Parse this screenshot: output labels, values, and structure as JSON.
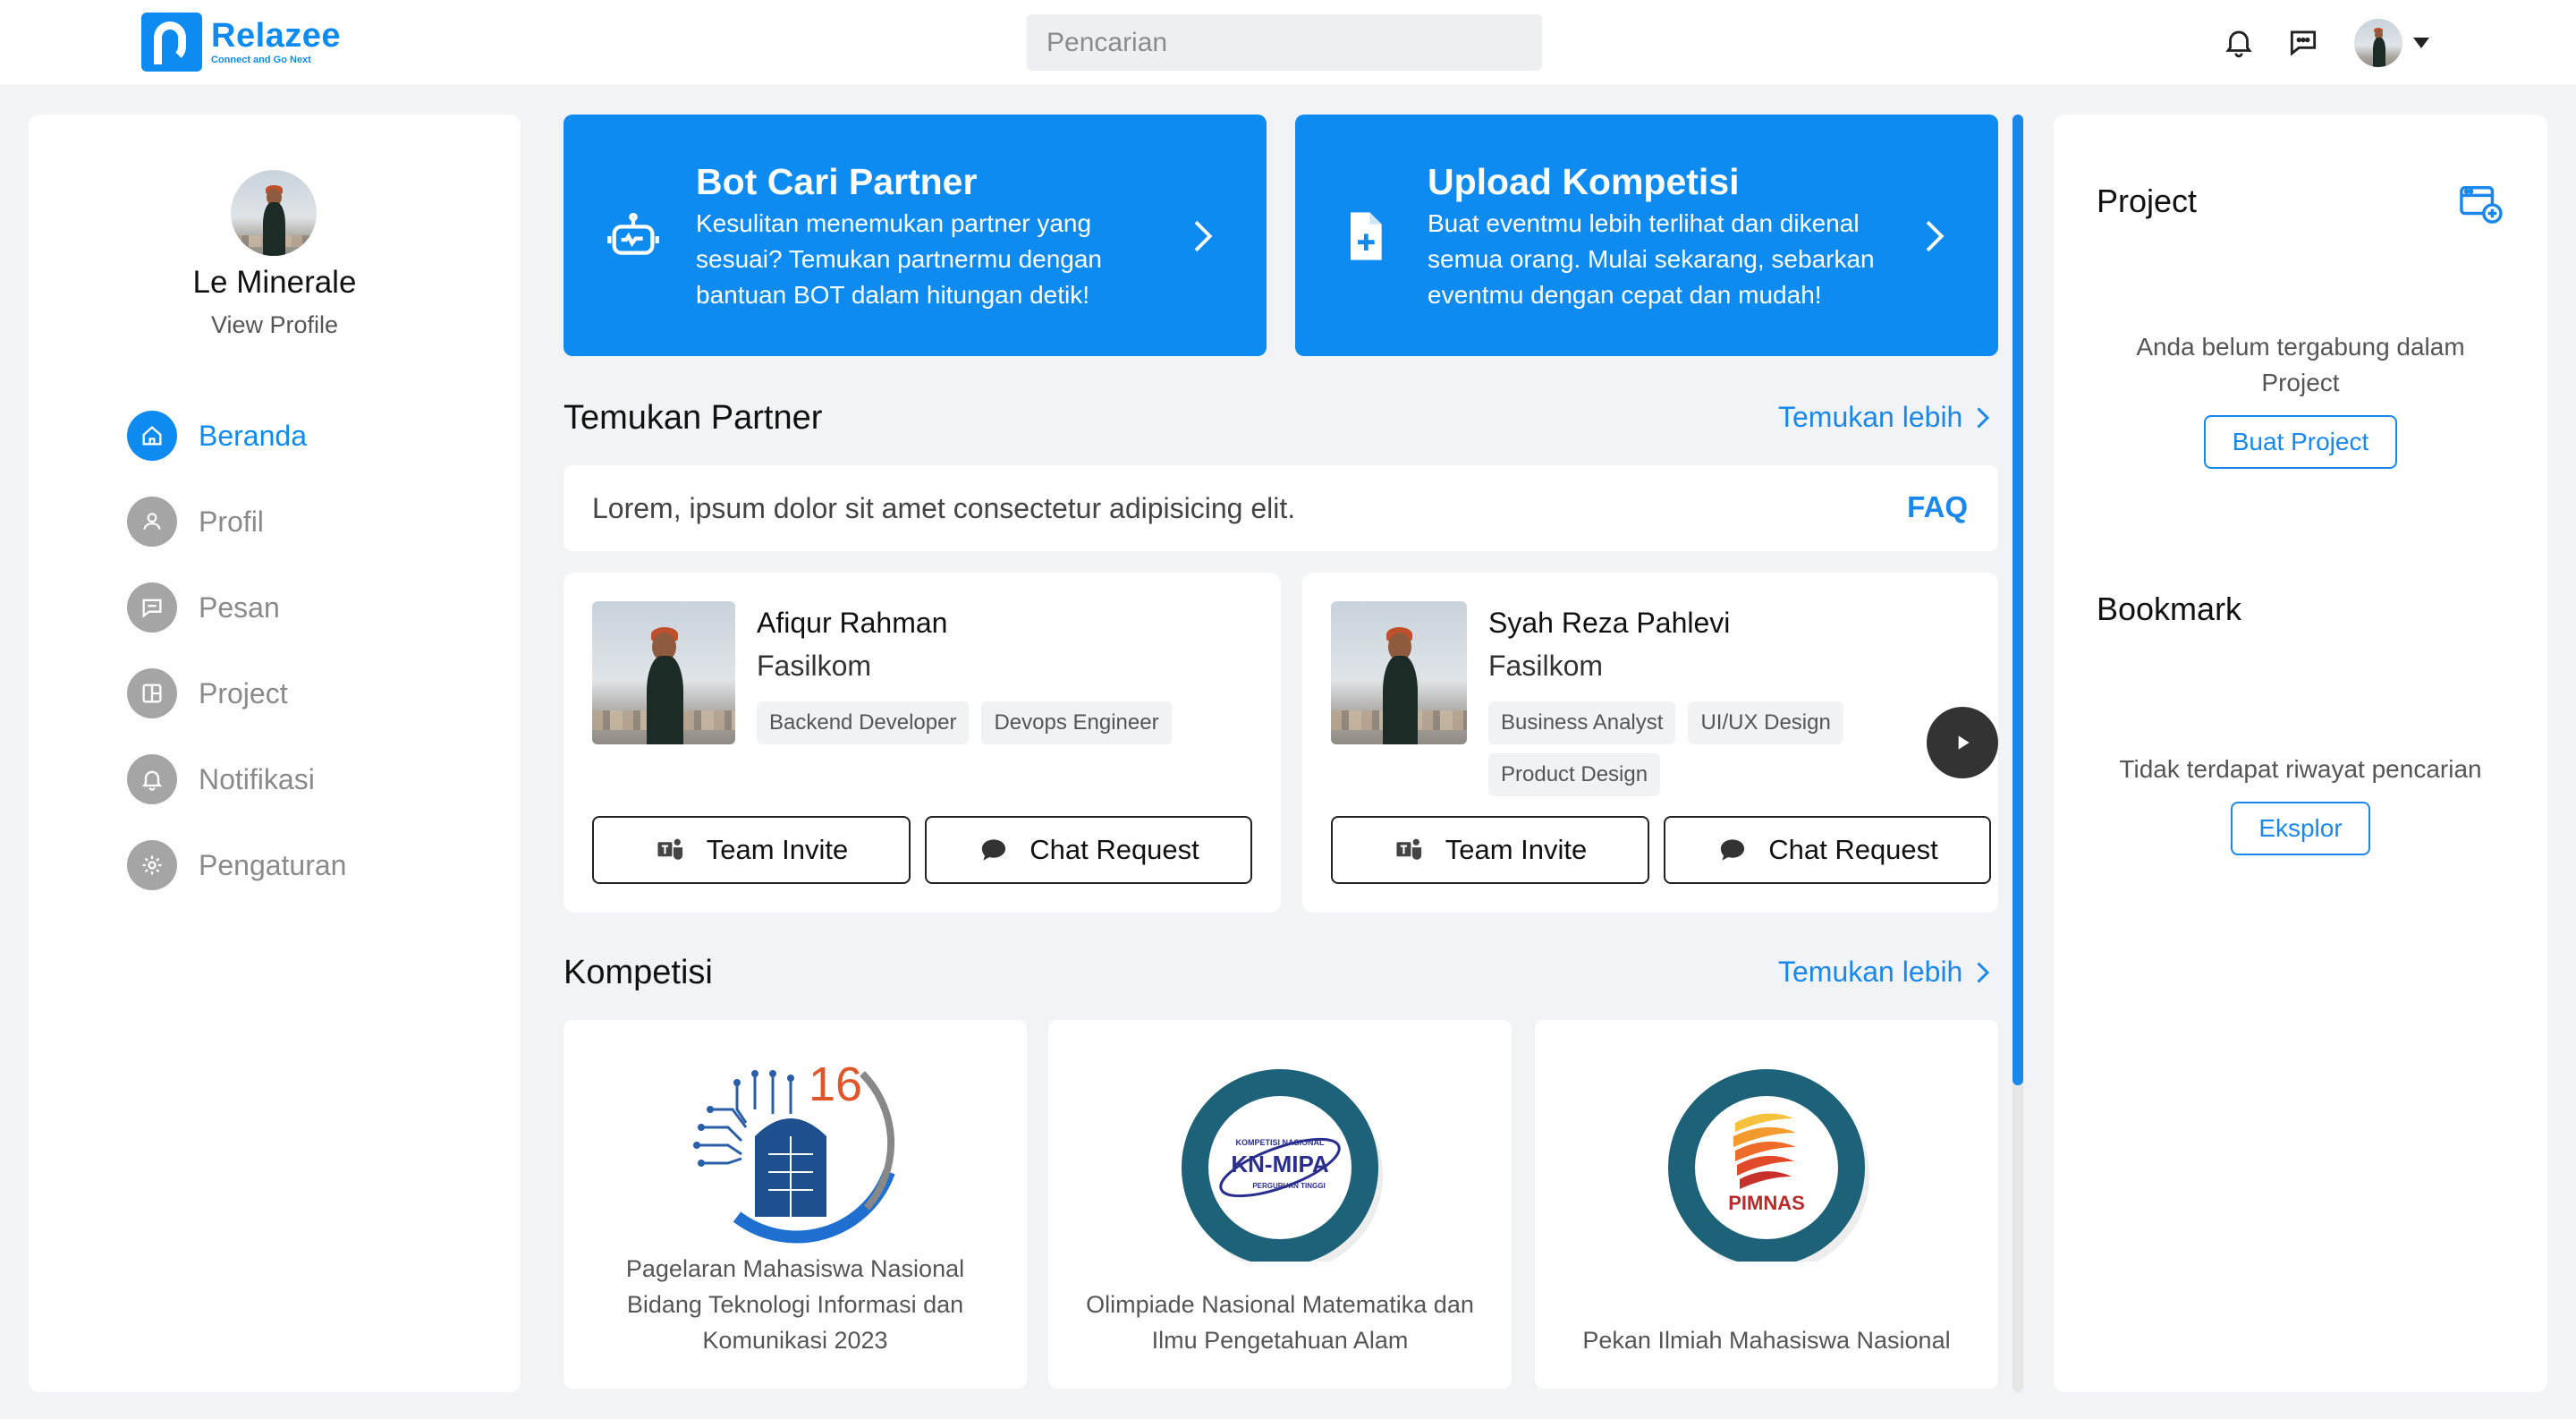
{
  "brand": {
    "name": "Relazee",
    "tagline": "Connect and Go Next",
    "accent": "#0d8bf0"
  },
  "search": {
    "placeholder": "Pencarian"
  },
  "header_icons": [
    "bell-icon",
    "chat-icon",
    "user-avatar",
    "caret-down-icon"
  ],
  "profile": {
    "name": "Le Minerale",
    "link": "View Profile"
  },
  "nav": [
    {
      "label": "Beranda",
      "icon": "home-icon",
      "active": true
    },
    {
      "label": "Profil",
      "icon": "user-icon",
      "active": false
    },
    {
      "label": "Pesan",
      "icon": "message-icon",
      "active": false
    },
    {
      "label": "Project",
      "icon": "layout-icon",
      "active": false
    },
    {
      "label": "Notifikasi",
      "icon": "bell-icon",
      "active": false
    },
    {
      "label": "Pengaturan",
      "icon": "gear-icon",
      "active": false
    }
  ],
  "banners": [
    {
      "title": "Bot Cari Partner",
      "desc": "Kesulitan menemukan partner yang sesuai? Temukan partnermu dengan bantuan BOT dalam hitungan detik!",
      "icon": "robot-icon"
    },
    {
      "title": "Upload Kompetisi",
      "desc": "Buat eventmu lebih terlihat dan dikenal semua orang. Mulai sekarang, sebarkan eventmu dengan cepat dan mudah!",
      "icon": "file-plus-icon"
    }
  ],
  "partner_section": {
    "title": "Temukan Partner",
    "more": "Temukan lebih",
    "faq_text": "Lorem, ipsum dolor sit amet consectetur adipisicing elit.",
    "faq_link": "FAQ"
  },
  "partners": [
    {
      "name": "Afiqur Rahman",
      "faculty": "Fasilkom",
      "tags": [
        "Backend Developer",
        "Devops Engineer"
      ],
      "invite": "Team Invite",
      "chat": "Chat Request"
    },
    {
      "name": "Syah Reza Pahlevi",
      "faculty": "Fasilkom",
      "tags": [
        "Business Analyst",
        "UI/UX Design",
        "Product Design"
      ],
      "invite": "Team Invite",
      "chat": "Chat Request"
    }
  ],
  "competition_section": {
    "title": "Kompetisi",
    "more": "Temukan lebih"
  },
  "competitions": [
    {
      "title": "Pagelaran Mahasiswa Nasional Bidang Teknologi Informasi dan Komunikasi 2023",
      "logo_text": "16"
    },
    {
      "title": "Olimpiade Nasional Matematika dan Ilmu Pengetahuan Alam",
      "logo_text": "KN-MIPA",
      "logo_top": "KOMPETISI NASIONAL",
      "logo_bottom": "PERGURUAN TINGGI"
    },
    {
      "title": "Pekan Ilmiah Mahasiswa Nasional",
      "logo_text": "PIMNAS"
    }
  ],
  "right_panel": {
    "project_title": "Project",
    "project_empty": "Anda belum tergabung dalam Project",
    "project_button": "Buat Project",
    "bookmark_title": "Bookmark",
    "bookmark_empty": "Tidak terdapat riwayat pencarian",
    "bookmark_button": "Eksplor"
  }
}
